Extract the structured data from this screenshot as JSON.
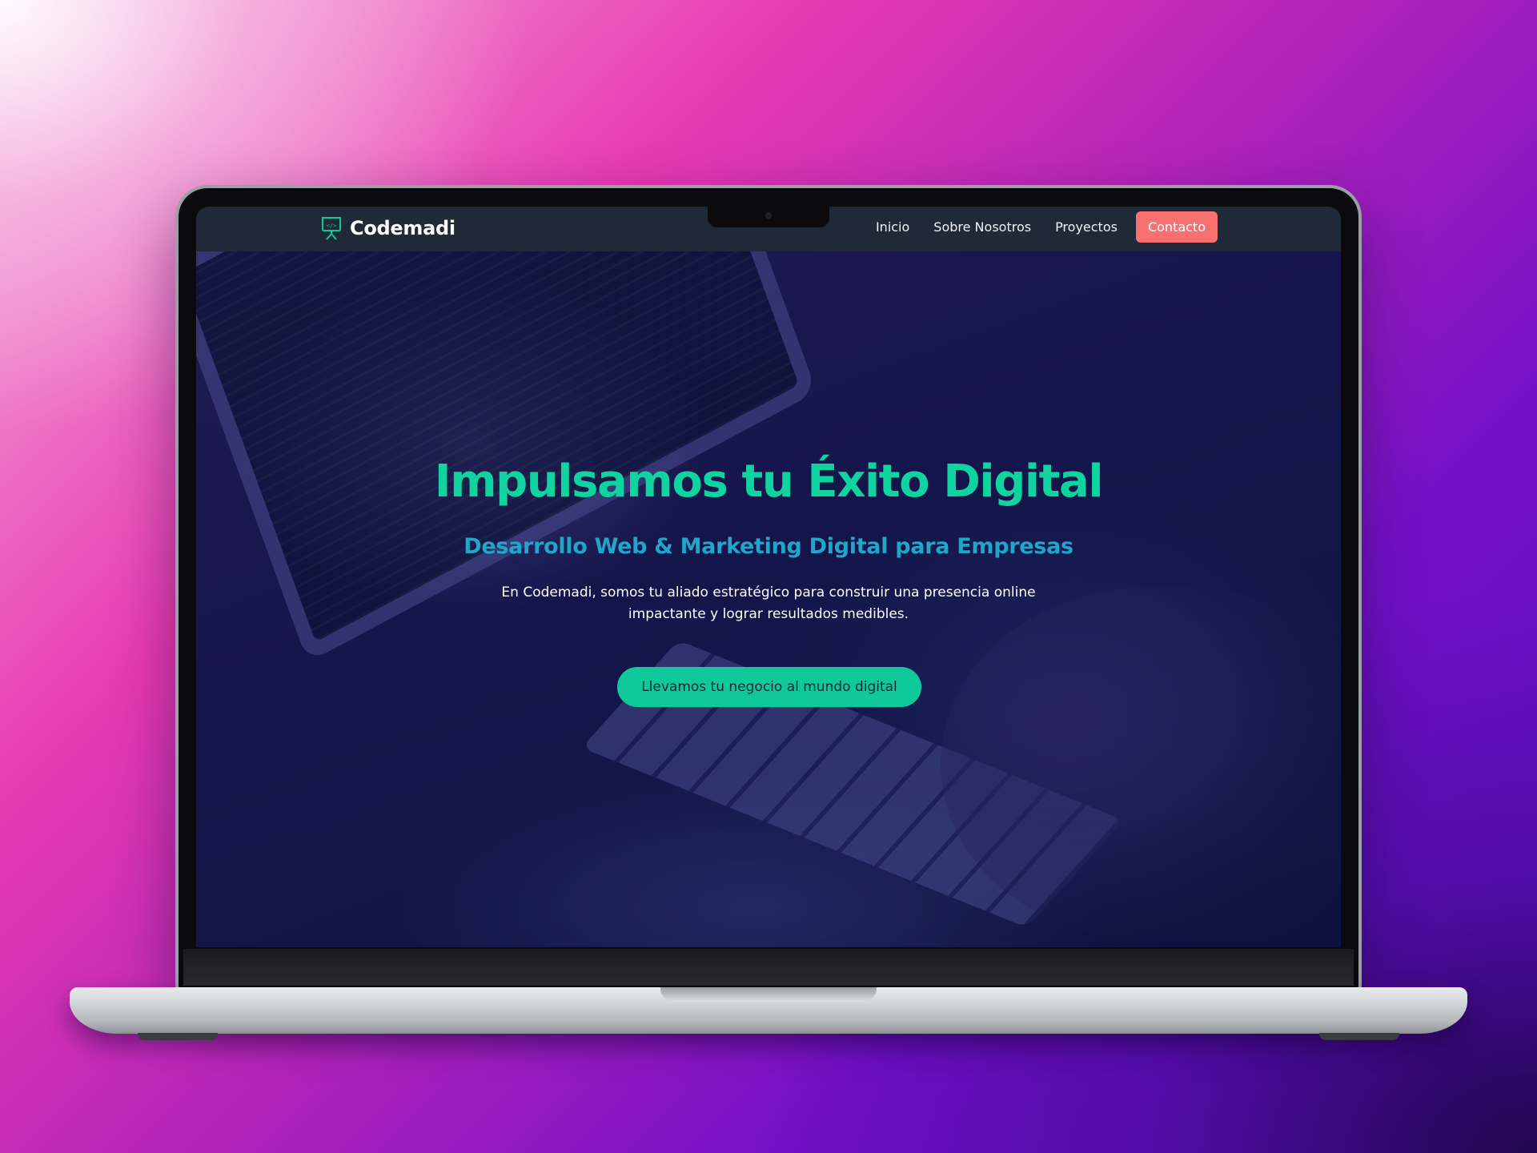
{
  "site": {
    "brand": {
      "name": "Codemadi",
      "icon": "presentation-board-icon"
    },
    "nav": {
      "items": [
        {
          "label": "Inicio"
        },
        {
          "label": "Sobre Nosotros"
        },
        {
          "label": "Proyectos"
        }
      ],
      "cta_label": "Contacto"
    },
    "hero": {
      "title": "Impulsamos tu Éxito Digital",
      "subtitle": "Desarrollo Web & Marketing Digital para Empresas",
      "text": "En Codemadi, somos tu aliado estratégico para construir una presencia online impactante y lograr resultados medibles.",
      "cta_label": "Llevamos tu negocio al mundo digital"
    }
  },
  "colors": {
    "nav_background": "#1f2937",
    "contact_button": "#f87171",
    "hero_title": "#10d4a0",
    "hero_subtitle": "#1fa6c8",
    "hero_button": "#10c99a",
    "page_background_start": "#f3b6dc",
    "page_background_end": "#5b0fc4"
  }
}
